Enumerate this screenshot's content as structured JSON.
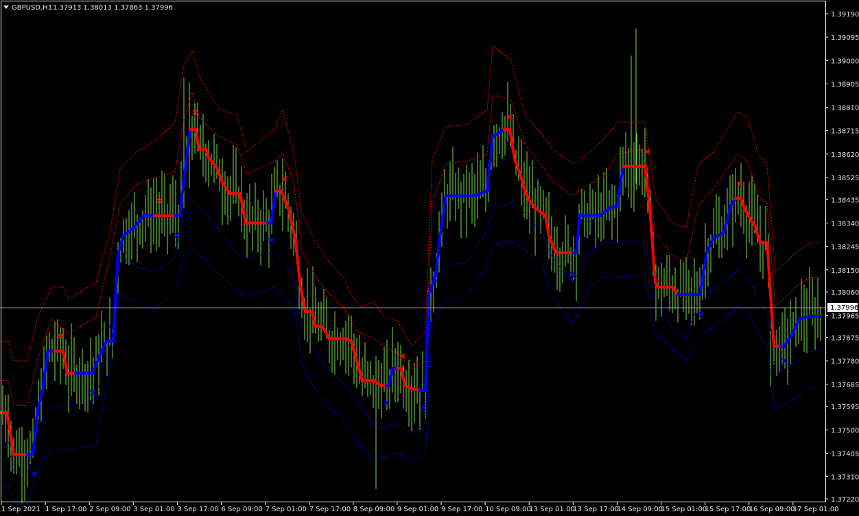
{
  "header": {
    "symbol": "GBPUSD,H1",
    "ohlc": "1.37913 1.38013 1.37863 1.37996",
    "menu_icon": "triangle-down-icon"
  },
  "current_price": "1.37996",
  "colors": {
    "background": "#000000",
    "foreground": "#ffffff",
    "candle": "#7cdf4a",
    "trend_up": "#0000ff",
    "trend_down": "#ff0000",
    "band_upper": "#ff0000",
    "band_lower": "#0000ff",
    "price_line": "#b0b0b0"
  },
  "chart_data": {
    "type": "line",
    "title": "",
    "ylim": [
      1.3718,
      1.3926
    ],
    "grid": false,
    "y_ticks": [
      "1.39190",
      "1.39095",
      "1.39000",
      "1.38905",
      "1.38810",
      "1.38715",
      "1.38620",
      "1.38525",
      "1.38435",
      "1.38340",
      "1.38245",
      "1.38150",
      "1.38060",
      "1.37965",
      "1.37875",
      "1.37780",
      "1.37685",
      "1.37595",
      "1.37500",
      "1.37405",
      "1.37310",
      "1.37220"
    ],
    "x_ticks": [
      "1 Sep 2021",
      "1 Sep 17:00",
      "2 Sep 09:00",
      "3 Sep 01:00",
      "3 Sep 17:00",
      "6 Sep 09:00",
      "7 Sep 01:00",
      "7 Sep 17:00",
      "8 Sep 09:00",
      "9 Sep 01:00",
      "9 Sep 17:00",
      "10 Sep 09:00",
      "13 Sep 01:00",
      "13 Sep 17:00",
      "14 Sep 09:00",
      "15 Sep 01:00",
      "15 Sep 17:00",
      "16 Sep 09:00",
      "17 Sep 01:00"
    ],
    "trend_points": [
      [
        0,
        1.3757,
        -1
      ],
      [
        10,
        1.3757,
        -1
      ],
      [
        20,
        1.374,
        -1
      ],
      [
        30,
        1.374,
        -1
      ],
      [
        40,
        1.374,
        -1
      ],
      [
        48,
        1.374,
        1
      ],
      [
        55,
        1.3758,
        1
      ],
      [
        62,
        1.3766,
        1
      ],
      [
        70,
        1.3782,
        1
      ],
      [
        80,
        1.3782,
        1
      ],
      [
        92,
        1.3782,
        -1
      ],
      [
        98,
        1.3773,
        -1
      ],
      [
        110,
        1.3773,
        -1
      ],
      [
        135,
        1.3773,
        1
      ],
      [
        145,
        1.378,
        1
      ],
      [
        155,
        1.3786,
        1
      ],
      [
        165,
        1.3786,
        1
      ],
      [
        172,
        1.3821,
        1
      ],
      [
        180,
        1.3829,
        1
      ],
      [
        195,
        1.3832,
        1
      ],
      [
        210,
        1.3837,
        1
      ],
      [
        225,
        1.3837,
        1
      ],
      [
        255,
        1.3837,
        -1
      ],
      [
        262,
        1.3837,
        1
      ],
      [
        270,
        1.3856,
        1
      ],
      [
        277,
        1.3872,
        1
      ],
      [
        285,
        1.3872,
        -1
      ],
      [
        290,
        1.3864,
        -1
      ],
      [
        300,
        1.3864,
        -1
      ],
      [
        305,
        1.386,
        -1
      ],
      [
        315,
        1.3857,
        -1
      ],
      [
        325,
        1.385,
        -1
      ],
      [
        335,
        1.3846,
        -1
      ],
      [
        350,
        1.3846,
        -1
      ],
      [
        358,
        1.3834,
        -1
      ],
      [
        390,
        1.3834,
        -1
      ],
      [
        395,
        1.3834,
        1
      ],
      [
        402,
        1.3847,
        1
      ],
      [
        410,
        1.3847,
        -1
      ],
      [
        420,
        1.384,
        -1
      ],
      [
        430,
        1.3828,
        -1
      ],
      [
        438,
        1.3808,
        -1
      ],
      [
        445,
        1.3798,
        -1
      ],
      [
        455,
        1.3798,
        -1
      ],
      [
        460,
        1.3792,
        -1
      ],
      [
        470,
        1.3792,
        -1
      ],
      [
        480,
        1.3787,
        -1
      ],
      [
        505,
        1.3787,
        -1
      ],
      [
        512,
        1.3786,
        -1
      ],
      [
        520,
        1.3778,
        -1
      ],
      [
        528,
        1.377,
        -1
      ],
      [
        545,
        1.377,
        -1
      ],
      [
        555,
        1.3768,
        -1
      ],
      [
        563,
        1.3768,
        -1
      ],
      [
        567,
        1.3768,
        1
      ],
      [
        572,
        1.3775,
        1
      ],
      [
        580,
        1.3775,
        1
      ],
      [
        585,
        1.3775,
        -1
      ],
      [
        590,
        1.3768,
        -1
      ],
      [
        598,
        1.3767,
        -1
      ],
      [
        612,
        1.3766,
        -1
      ],
      [
        620,
        1.3766,
        1
      ],
      [
        625,
        1.3805,
        1
      ],
      [
        635,
        1.3813,
        1
      ],
      [
        642,
        1.383,
        1
      ],
      [
        650,
        1.3845,
        1
      ],
      [
        660,
        1.3845,
        1
      ],
      [
        690,
        1.3845,
        1
      ],
      [
        710,
        1.3847,
        1
      ],
      [
        718,
        1.3869,
        1
      ],
      [
        735,
        1.3872,
        1
      ],
      [
        743,
        1.3872,
        -1
      ],
      [
        750,
        1.386,
        -1
      ],
      [
        758,
        1.3854,
        -1
      ],
      [
        765,
        1.3847,
        -1
      ],
      [
        772,
        1.3843,
        -1
      ],
      [
        780,
        1.384,
        -1
      ],
      [
        795,
        1.3837,
        -1
      ],
      [
        800,
        1.3829,
        -1
      ],
      [
        810,
        1.3822,
        -1
      ],
      [
        835,
        1.3822,
        -1
      ],
      [
        840,
        1.3822,
        1
      ],
      [
        845,
        1.3837,
        1
      ],
      [
        875,
        1.3837,
        1
      ],
      [
        888,
        1.384,
        1
      ],
      [
        900,
        1.3841,
        1
      ],
      [
        908,
        1.3857,
        1
      ],
      [
        940,
        1.3857,
        -1
      ],
      [
        947,
        1.384,
        -1
      ],
      [
        955,
        1.381,
        -1
      ],
      [
        960,
        1.3808,
        -1
      ],
      [
        980,
        1.3808,
        -1
      ],
      [
        988,
        1.3805,
        -1
      ],
      [
        1020,
        1.3805,
        1
      ],
      [
        1030,
        1.3822,
        1
      ],
      [
        1040,
        1.3828,
        1
      ],
      [
        1055,
        1.383,
        1
      ],
      [
        1065,
        1.3841,
        1
      ],
      [
        1072,
        1.3844,
        1
      ],
      [
        1080,
        1.3844,
        -1
      ],
      [
        1085,
        1.384,
        -1
      ],
      [
        1095,
        1.3835,
        -1
      ],
      [
        1100,
        1.3833,
        -1
      ],
      [
        1108,
        1.3826,
        -1
      ],
      [
        1118,
        1.3826,
        -1
      ],
      [
        1128,
        1.3784,
        -1
      ],
      [
        1138,
        1.3784,
        -1
      ],
      [
        1143,
        1.3784,
        1
      ],
      [
        1155,
        1.3789,
        1
      ],
      [
        1165,
        1.3795,
        1
      ],
      [
        1180,
        1.3796,
        1
      ],
      [
        1196,
        1.3796,
        1
      ]
    ],
    "upper_band": [
      [
        0,
        1.3786
      ],
      [
        12,
        1.3786
      ],
      [
        20,
        1.3778
      ],
      [
        40,
        1.3778
      ],
      [
        55,
        1.3796
      ],
      [
        75,
        1.3808
      ],
      [
        92,
        1.3808
      ],
      [
        100,
        1.3803
      ],
      [
        140,
        1.381
      ],
      [
        160,
        1.383
      ],
      [
        175,
        1.3856
      ],
      [
        200,
        1.3863
      ],
      [
        225,
        1.3867
      ],
      [
        255,
        1.3875
      ],
      [
        268,
        1.3898
      ],
      [
        280,
        1.3904
      ],
      [
        290,
        1.3894
      ],
      [
        300,
        1.3889
      ],
      [
        320,
        1.388
      ],
      [
        345,
        1.3878
      ],
      [
        360,
        1.3863
      ],
      [
        400,
        1.3872
      ],
      [
        412,
        1.388
      ],
      [
        428,
        1.3863
      ],
      [
        440,
        1.3838
      ],
      [
        460,
        1.3826
      ],
      [
        480,
        1.3818
      ],
      [
        500,
        1.3812
      ],
      [
        510,
        1.3806
      ],
      [
        525,
        1.38
      ],
      [
        545,
        1.3802
      ],
      [
        560,
        1.3796
      ],
      [
        580,
        1.3794
      ],
      [
        600,
        1.3784
      ],
      [
        620,
        1.379
      ],
      [
        630,
        1.386
      ],
      [
        650,
        1.3873
      ],
      [
        680,
        1.3874
      ],
      [
        710,
        1.388
      ],
      [
        718,
        1.3906
      ],
      [
        745,
        1.39
      ],
      [
        765,
        1.3878
      ],
      [
        790,
        1.387
      ],
      [
        805,
        1.3864
      ],
      [
        835,
        1.3858
      ],
      [
        860,
        1.3863
      ],
      [
        880,
        1.3868
      ],
      [
        900,
        1.3875
      ],
      [
        940,
        1.3875
      ],
      [
        955,
        1.3844
      ],
      [
        980,
        1.3834
      ],
      [
        1000,
        1.3832
      ],
      [
        1018,
        1.3858
      ],
      [
        1040,
        1.3863
      ],
      [
        1060,
        1.3872
      ],
      [
        1075,
        1.3879
      ],
      [
        1090,
        1.3877
      ],
      [
        1105,
        1.3862
      ],
      [
        1118,
        1.3858
      ],
      [
        1130,
        1.3814
      ],
      [
        1160,
        1.3822
      ],
      [
        1180,
        1.3826
      ],
      [
        1196,
        1.3826
      ]
    ],
    "mid_upper_band": [
      [
        0,
        1.377
      ],
      [
        12,
        1.377
      ],
      [
        20,
        1.376
      ],
      [
        40,
        1.376
      ],
      [
        55,
        1.3779
      ],
      [
        75,
        1.3795
      ],
      [
        100,
        1.3789
      ],
      [
        140,
        1.3796
      ],
      [
        160,
        1.382
      ],
      [
        175,
        1.3842
      ],
      [
        200,
        1.385
      ],
      [
        225,
        1.3852
      ],
      [
        255,
        1.3855
      ],
      [
        268,
        1.3876
      ],
      [
        280,
        1.3887
      ],
      [
        290,
        1.3877
      ],
      [
        320,
        1.3869
      ],
      [
        345,
        1.3866
      ],
      [
        360,
        1.3854
      ],
      [
        400,
        1.3859
      ],
      [
        412,
        1.3862
      ],
      [
        428,
        1.3851
      ],
      [
        440,
        1.3823
      ],
      [
        460,
        1.3812
      ],
      [
        480,
        1.3805
      ],
      [
        500,
        1.38
      ],
      [
        520,
        1.379
      ],
      [
        545,
        1.3787
      ],
      [
        560,
        1.3784
      ],
      [
        580,
        1.3781
      ],
      [
        600,
        1.3775
      ],
      [
        620,
        1.3778
      ],
      [
        630,
        1.3842
      ],
      [
        650,
        1.3858
      ],
      [
        680,
        1.3859
      ],
      [
        710,
        1.3862
      ],
      [
        718,
        1.3886
      ],
      [
        745,
        1.3884
      ],
      [
        765,
        1.3866
      ],
      [
        790,
        1.3857
      ],
      [
        805,
        1.3851
      ],
      [
        835,
        1.3845
      ],
      [
        860,
        1.385
      ],
      [
        880,
        1.3853
      ],
      [
        900,
        1.3862
      ],
      [
        940,
        1.3864
      ],
      [
        955,
        1.383
      ],
      [
        980,
        1.3821
      ],
      [
        1000,
        1.3818
      ],
      [
        1018,
        1.3841
      ],
      [
        1040,
        1.3848
      ],
      [
        1060,
        1.3856
      ],
      [
        1075,
        1.3862
      ],
      [
        1090,
        1.3859
      ],
      [
        1105,
        1.3845
      ],
      [
        1118,
        1.3842
      ],
      [
        1130,
        1.38
      ],
      [
        1160,
        1.3808
      ],
      [
        1180,
        1.3812
      ],
      [
        1196,
        1.3812
      ]
    ],
    "mid_lower_band": [
      [
        0,
        1.3745
      ],
      [
        12,
        1.3745
      ],
      [
        20,
        1.3733
      ],
      [
        40,
        1.3733
      ],
      [
        55,
        1.3752
      ],
      [
        75,
        1.3759
      ],
      [
        100,
        1.376
      ],
      [
        140,
        1.3762
      ],
      [
        160,
        1.3792
      ],
      [
        175,
        1.382
      ],
      [
        200,
        1.3816
      ],
      [
        225,
        1.3814
      ],
      [
        255,
        1.382
      ],
      [
        268,
        1.3838
      ],
      [
        280,
        1.3844
      ],
      [
        300,
        1.3838
      ],
      [
        320,
        1.3831
      ],
      [
        345,
        1.3822
      ],
      [
        360,
        1.382
      ],
      [
        400,
        1.3822
      ],
      [
        428,
        1.3813
      ],
      [
        440,
        1.379
      ],
      [
        460,
        1.3781
      ],
      [
        480,
        1.3774
      ],
      [
        500,
        1.3769
      ],
      [
        520,
        1.3762
      ],
      [
        545,
        1.3752
      ],
      [
        560,
        1.3751
      ],
      [
        580,
        1.3753
      ],
      [
        600,
        1.3748
      ],
      [
        620,
        1.3753
      ],
      [
        630,
        1.3808
      ],
      [
        650,
        1.3817
      ],
      [
        680,
        1.3818
      ],
      [
        710,
        1.3831
      ],
      [
        718,
        1.384
      ],
      [
        745,
        1.3842
      ],
      [
        765,
        1.3838
      ],
      [
        790,
        1.383
      ],
      [
        805,
        1.382
      ],
      [
        835,
        1.381
      ],
      [
        860,
        1.3822
      ],
      [
        880,
        1.3826
      ],
      [
        900,
        1.3826
      ],
      [
        940,
        1.3827
      ],
      [
        955,
        1.3803
      ],
      [
        980,
        1.3791
      ],
      [
        1000,
        1.3787
      ],
      [
        1018,
        1.3802
      ],
      [
        1040,
        1.3808
      ],
      [
        1060,
        1.3811
      ],
      [
        1075,
        1.3815
      ],
      [
        1090,
        1.3812
      ],
      [
        1105,
        1.3803
      ],
      [
        1118,
        1.3798
      ],
      [
        1130,
        1.3773
      ],
      [
        1160,
        1.3777
      ],
      [
        1180,
        1.3782
      ],
      [
        1196,
        1.3782
      ]
    ],
    "lower_band": [
      [
        0,
        1.3727
      ],
      [
        12,
        1.3727
      ],
      [
        20,
        1.372
      ],
      [
        40,
        1.372
      ],
      [
        55,
        1.3734
      ],
      [
        75,
        1.3742
      ],
      [
        100,
        1.3742
      ],
      [
        140,
        1.3744
      ],
      [
        160,
        1.3775
      ],
      [
        175,
        1.3805
      ],
      [
        200,
        1.3802
      ],
      [
        225,
        1.3799
      ],
      [
        255,
        1.3806
      ],
      [
        268,
        1.382
      ],
      [
        280,
        1.3823
      ],
      [
        300,
        1.3819
      ],
      [
        320,
        1.3813
      ],
      [
        345,
        1.3807
      ],
      [
        360,
        1.3804
      ],
      [
        400,
        1.3808
      ],
      [
        428,
        1.38
      ],
      [
        440,
        1.3777
      ],
      [
        460,
        1.3766
      ],
      [
        480,
        1.3759
      ],
      [
        500,
        1.3755
      ],
      [
        520,
        1.3745
      ],
      [
        545,
        1.3738
      ],
      [
        560,
        1.3739
      ],
      [
        580,
        1.3741
      ],
      [
        600,
        1.3737
      ],
      [
        620,
        1.374
      ],
      [
        630,
        1.3792
      ],
      [
        650,
        1.3803
      ],
      [
        680,
        1.3804
      ],
      [
        710,
        1.3817
      ],
      [
        718,
        1.3825
      ],
      [
        745,
        1.3827
      ],
      [
        765,
        1.3823
      ],
      [
        790,
        1.3817
      ],
      [
        805,
        1.3804
      ],
      [
        835,
        1.3793
      ],
      [
        860,
        1.3808
      ],
      [
        880,
        1.3812
      ],
      [
        900,
        1.3812
      ],
      [
        940,
        1.3813
      ],
      [
        955,
        1.3789
      ],
      [
        980,
        1.3783
      ],
      [
        1000,
        1.3778
      ],
      [
        1018,
        1.3788
      ],
      [
        1040,
        1.3792
      ],
      [
        1060,
        1.3796
      ],
      [
        1075,
        1.38
      ],
      [
        1090,
        1.3798
      ],
      [
        1105,
        1.3789
      ],
      [
        1118,
        1.3784
      ],
      [
        1130,
        1.3758
      ],
      [
        1160,
        1.3763
      ],
      [
        1180,
        1.3767
      ],
      [
        1196,
        1.3767
      ]
    ],
    "buy_markers": [
      [
        50,
        1.3732
      ],
      [
        135,
        1.3765
      ],
      [
        258,
        1.3829
      ],
      [
        395,
        1.3827
      ],
      [
        563,
        1.3761
      ],
      [
        618,
        1.3759
      ],
      [
        834,
        1.3813
      ],
      [
        1022,
        1.3797
      ],
      [
        1143,
        1.3778
      ]
    ],
    "sell_markers": [
      [
        88,
        1.3788
      ],
      [
        232,
        1.3843
      ],
      [
        284,
        1.3879
      ],
      [
        415,
        1.3852
      ],
      [
        587,
        1.378
      ],
      [
        743,
        1.3877
      ],
      [
        943,
        1.3863
      ],
      [
        1079,
        1.385
      ]
    ],
    "spikes": [
      [
        268,
        1.3893,
        1.384
      ],
      [
        276,
        1.3891,
        1.3848
      ],
      [
        548,
        1.3775,
        1.3726
      ],
      [
        920,
        1.3902,
        1.384
      ],
      [
        927,
        1.3913,
        1.385
      ],
      [
        1123,
        1.379,
        1.3768
      ]
    ]
  }
}
